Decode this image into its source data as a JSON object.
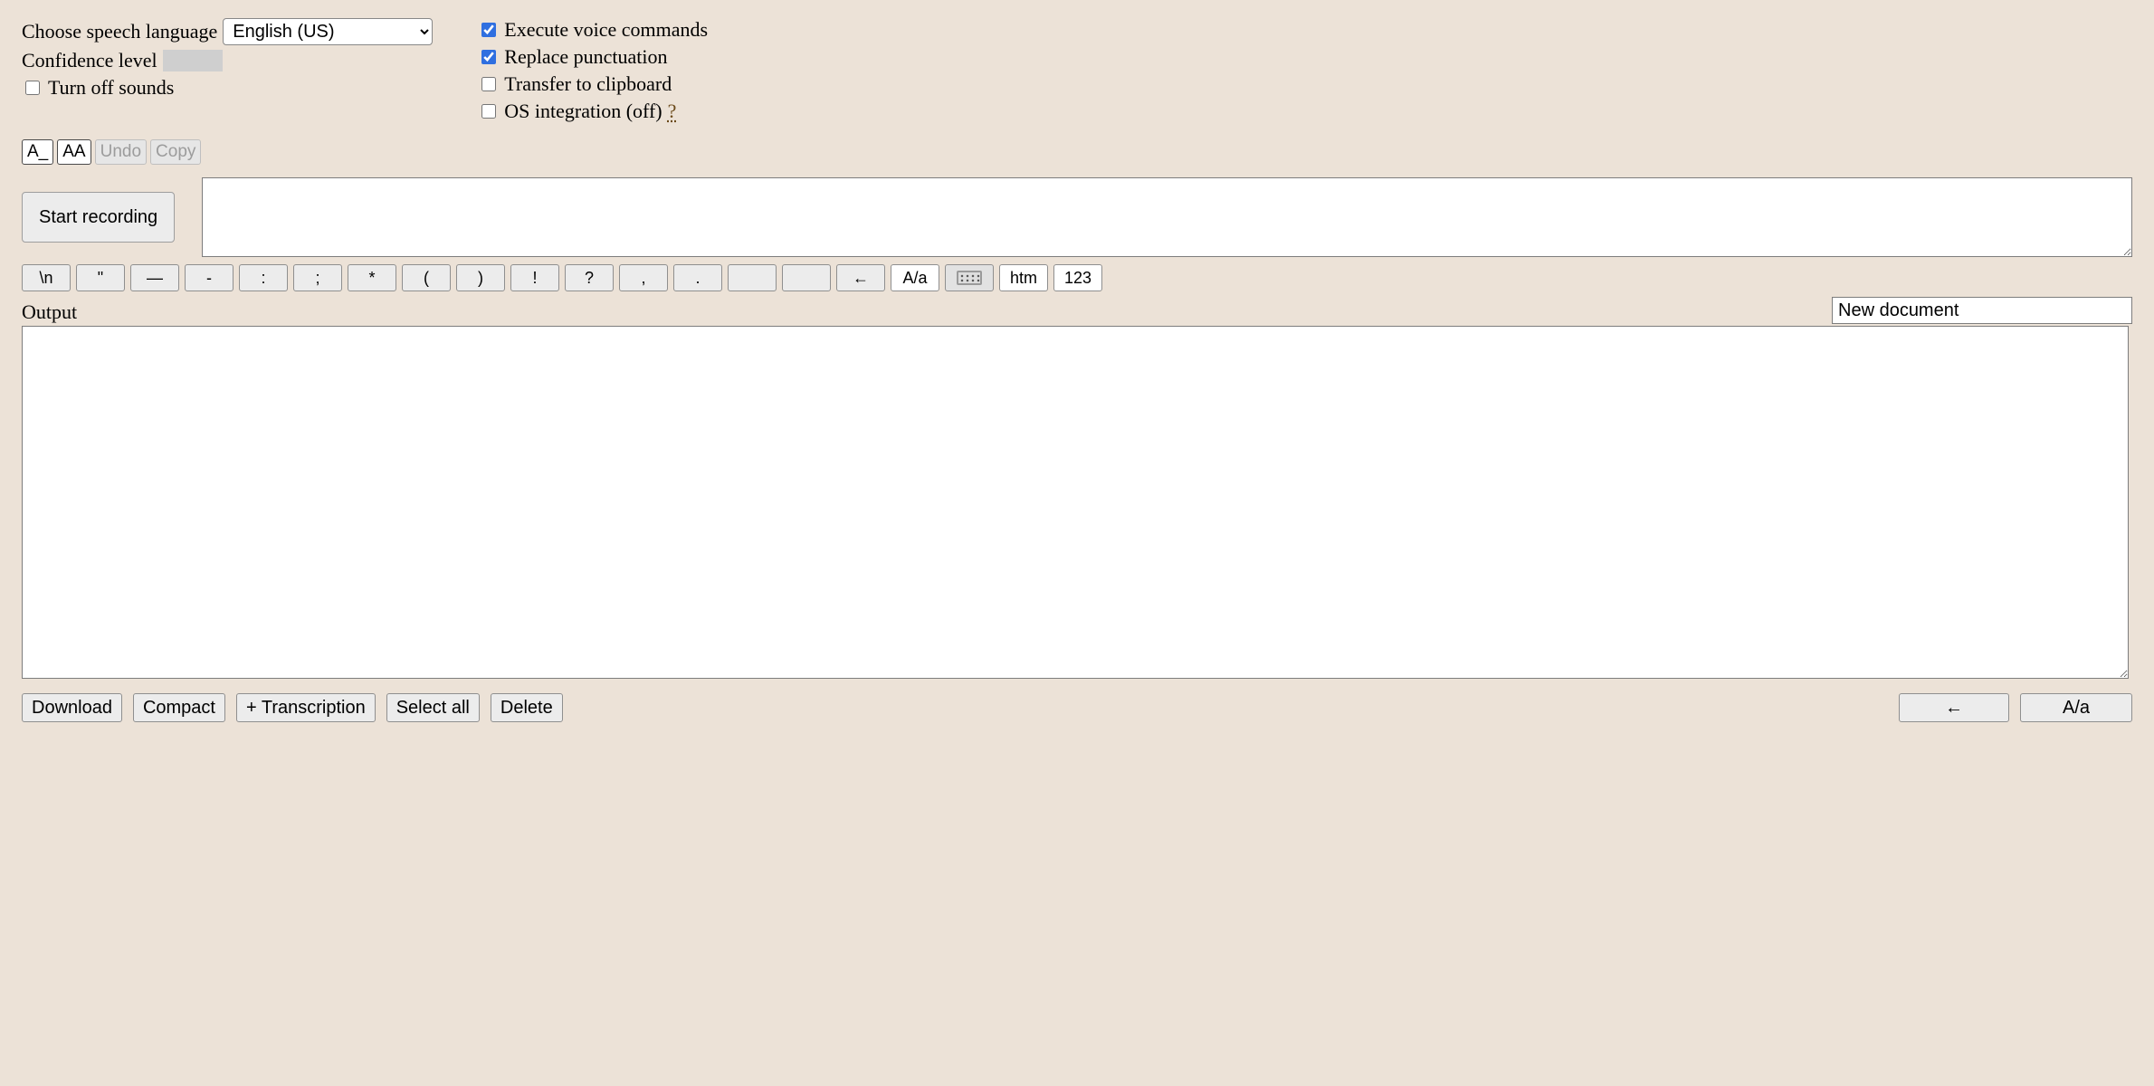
{
  "top": {
    "language_label": "Choose speech language",
    "language_value": "English (US)",
    "confidence_label": "Confidence level",
    "confidence_value": "",
    "turn_off_sounds_label": "Turn off sounds",
    "turn_off_sounds_checked": false,
    "options": {
      "execute_cmds_label": "Execute voice commands",
      "execute_cmds_checked": true,
      "replace_punct_label": "Replace punctuation",
      "replace_punct_checked": true,
      "clipboard_label": "Transfer to clipboard",
      "clipboard_checked": false,
      "os_integration_label": "OS integration (off)",
      "os_integration_checked": false,
      "os_integration_help": "?"
    }
  },
  "toolbar": {
    "small_a": "A_",
    "large_a": "AA",
    "undo": "Undo",
    "copy": "Copy"
  },
  "record": {
    "start_label": "Start recording",
    "transcription_value": ""
  },
  "strip": {
    "newline": "\\n",
    "quote": "\"",
    "mdash": "—",
    "hyphen": "-",
    "colon": ":",
    "semicolon": ";",
    "asterisk": "*",
    "lparen": "(",
    "rparen": ")",
    "bang": "!",
    "qmark": "?",
    "comma": ",",
    "period": ".",
    "blank1": "",
    "blank2": "",
    "back_arrow": "←",
    "case_toggle": "A/a",
    "htm": "htm",
    "numbers": "123"
  },
  "output": {
    "label": "Output",
    "doc_title": "New document",
    "value": ""
  },
  "bottom": {
    "download": "Download",
    "compact": "Compact",
    "add_transcription": "+ Transcription",
    "select_all": "Select all",
    "delete": "Delete",
    "back_arrow": "←",
    "case_toggle": "A/a"
  }
}
